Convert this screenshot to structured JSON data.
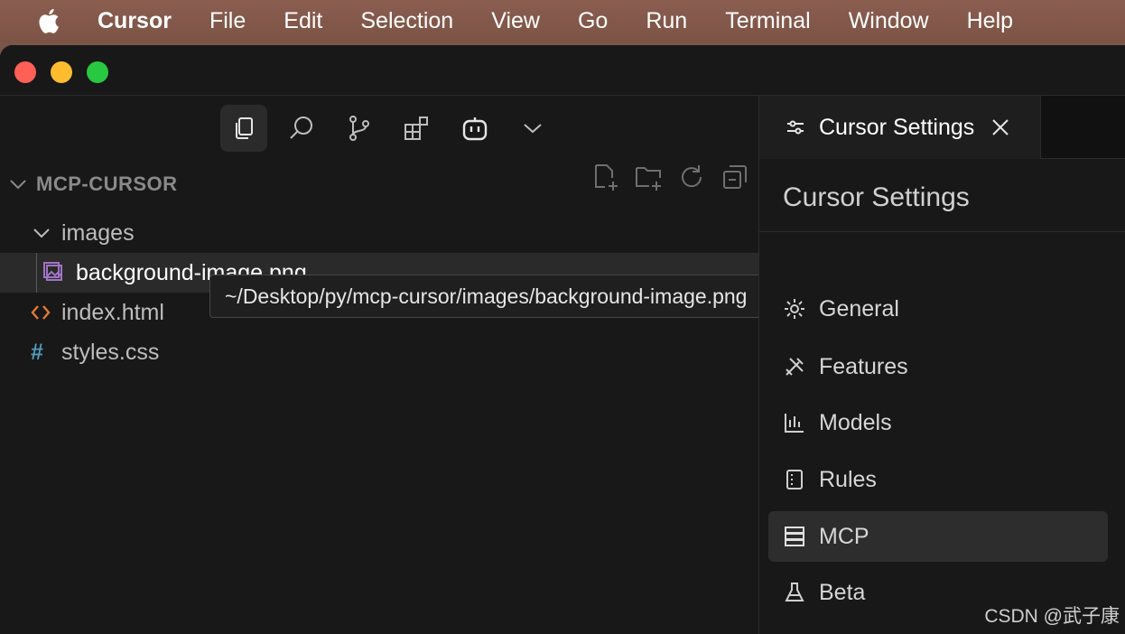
{
  "menubar": {
    "apple_icon": "apple-icon",
    "items": [
      "Cursor",
      "File",
      "Edit",
      "Selection",
      "View",
      "Go",
      "Run",
      "Terminal",
      "Window",
      "Help"
    ]
  },
  "activity_bar": {
    "icons": [
      "files-icon",
      "search-icon",
      "source-control-icon",
      "extensions-icon",
      "agent-icon",
      "chevron-down-icon"
    ]
  },
  "explorer": {
    "section_title": "MCP-CURSOR",
    "actions": [
      "new-file-icon",
      "new-folder-icon",
      "refresh-icon",
      "collapse-all-icon"
    ],
    "tree": [
      {
        "label": "images",
        "type": "folder"
      },
      {
        "label": "background-image.png",
        "type": "image"
      },
      {
        "label": "index.html",
        "type": "html"
      },
      {
        "label": "styles.css",
        "type": "css"
      }
    ]
  },
  "tooltip": {
    "text": "~/Desktop/py/mcp-cursor/images/background-image.png"
  },
  "settings": {
    "tab_label": "Cursor Settings",
    "title": "Cursor Settings",
    "nav": [
      {
        "label": "General",
        "icon": "gear-icon"
      },
      {
        "label": "Features",
        "icon": "tools-icon"
      },
      {
        "label": "Models",
        "icon": "chart-icon"
      },
      {
        "label": "Rules",
        "icon": "book-icon"
      },
      {
        "label": "MCP",
        "icon": "server-icon",
        "active": true
      },
      {
        "label": "Beta",
        "icon": "flask-icon"
      }
    ]
  },
  "watermark": "CSDN @武子康",
  "colors": {
    "menubar": "#7c5446",
    "editor_bg": "#181818",
    "html_icon": "#e37933",
    "css_icon": "#519aba",
    "image_icon": "#a074c4"
  }
}
